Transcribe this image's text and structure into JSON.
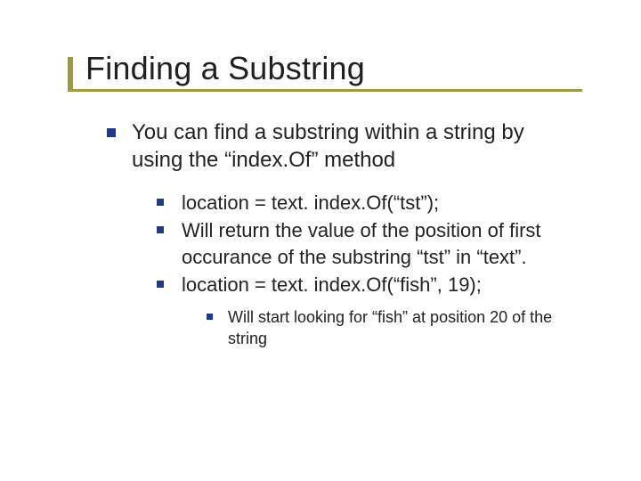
{
  "title": "Finding a Substring",
  "b1": {
    "text": "You can find a substring within a string by using the “index.Of” method"
  },
  "b2": {
    "i0": "  location = text. index.Of(“tst”);",
    "i1": "Will return the value of the position of first occurance of the substring “tst” in “text”.",
    "i2": "  location = text. index.Of(“fish”, 19);"
  },
  "b3": {
    "i0": "Will start looking for “fish” at position 20 of the string"
  }
}
